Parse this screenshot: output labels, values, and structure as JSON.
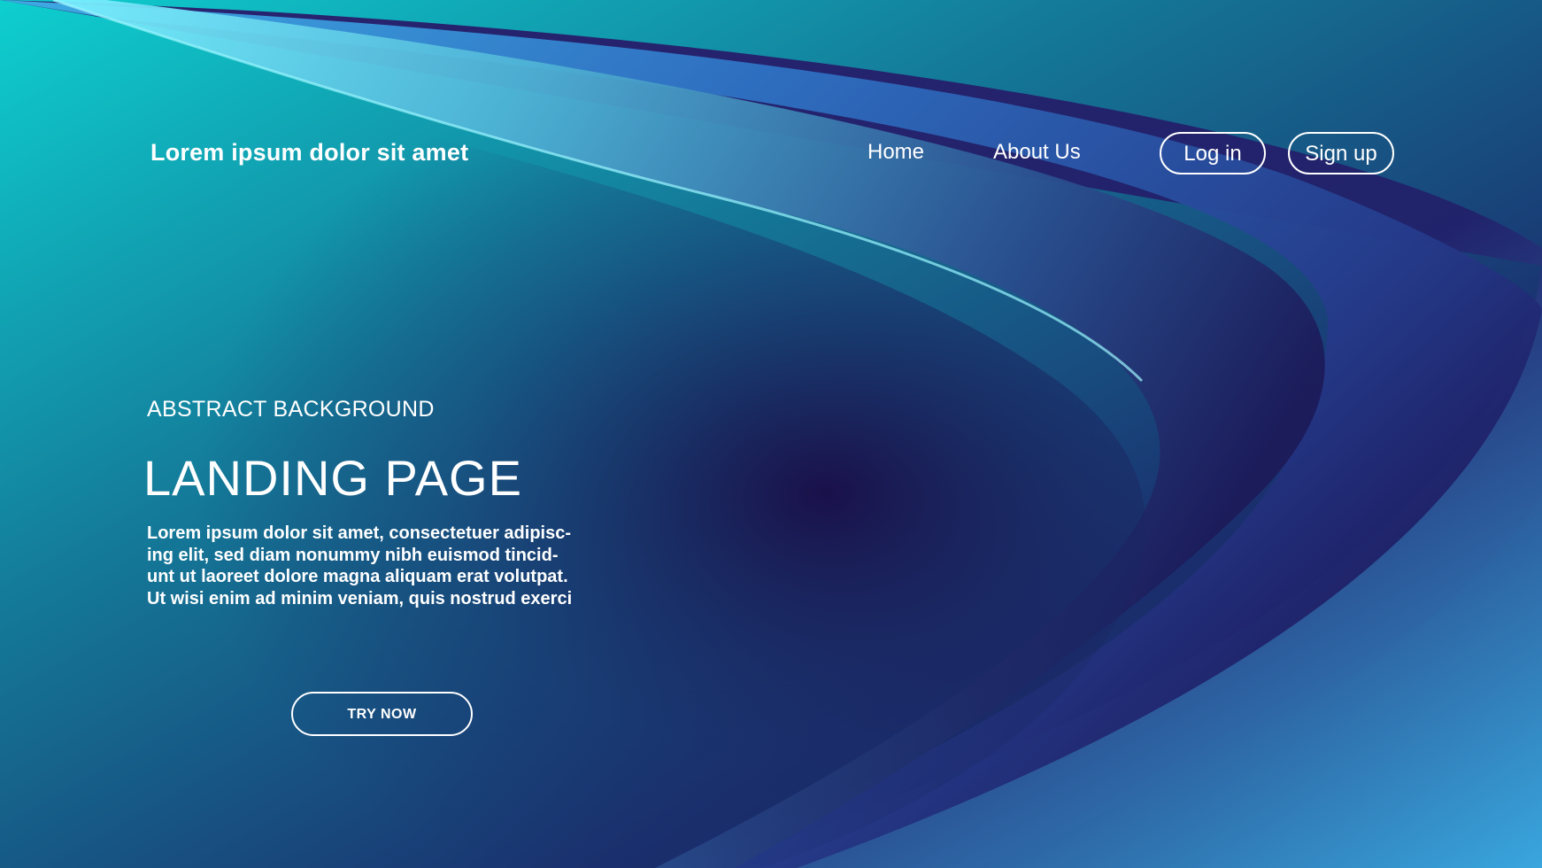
{
  "header": {
    "brand": "Lorem ipsum dolor sit amet",
    "nav": {
      "home": "Home",
      "about": "About Us"
    },
    "login_label": "Log in",
    "signup_label": "Sign up"
  },
  "hero": {
    "eyebrow": "ABSTRACT BACKGROUND",
    "title": "LANDING PAGE",
    "body_lines": [
      "Lorem ipsum dolor sit amet, consectetuer adipisc-",
      "ing elit, sed diam nonummy nibh euismod tincid-",
      "unt ut laoreet dolore magna aliquam erat volutpat.",
      "Ut wisi enim ad minim veniam, quis nostrud exerci"
    ],
    "cta_label": "TRY NOW"
  },
  "colors": {
    "teal": "#0ecfcf",
    "deep_navy": "#1f0b47",
    "mid_blue": "#174c7e",
    "highlight_cyan": "#7af0ff",
    "wave_blue": "#3d8fd8",
    "text": "#ffffff"
  }
}
